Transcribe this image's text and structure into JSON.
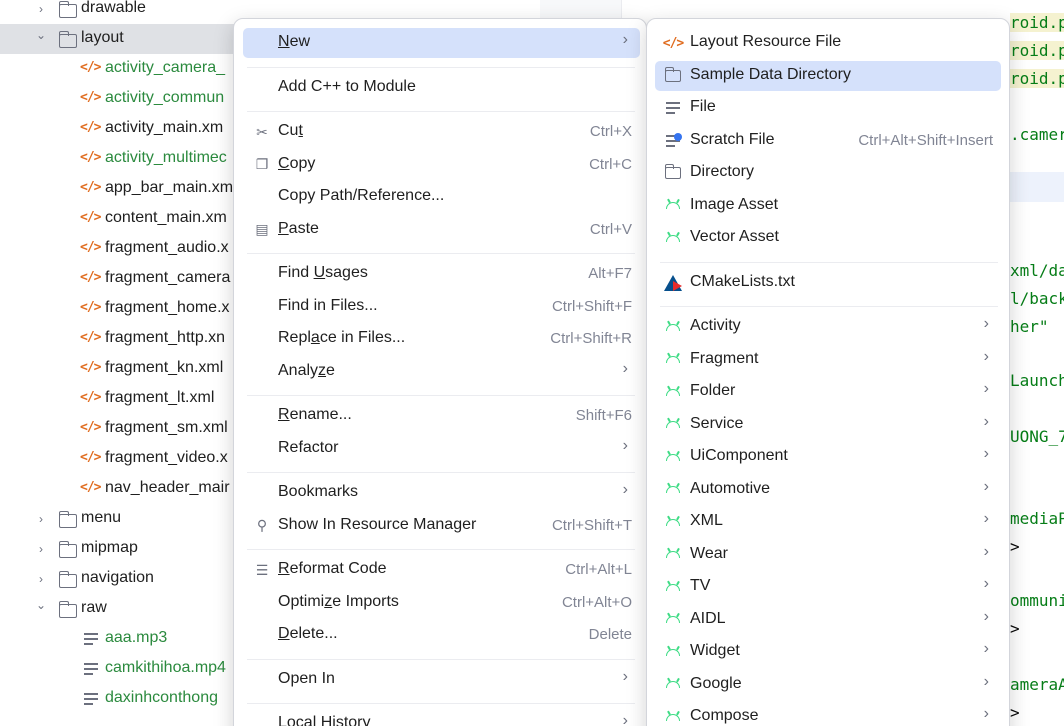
{
  "tree": {
    "rows": [
      {
        "label": "drawable",
        "kind": "folder",
        "expanded": false,
        "indent": 1
      },
      {
        "label": "layout",
        "kind": "folder",
        "expanded": true,
        "indent": 1,
        "selected": true
      },
      {
        "label": "activity_camera_",
        "kind": "xml",
        "color": "green"
      },
      {
        "label": "activity_commun",
        "kind": "xml",
        "color": "green"
      },
      {
        "label": "activity_main.xm",
        "kind": "xml",
        "color": "dark"
      },
      {
        "label": "activity_multimec",
        "kind": "xml",
        "color": "green"
      },
      {
        "label": "app_bar_main.xm",
        "kind": "xml",
        "color": "dark"
      },
      {
        "label": "content_main.xm",
        "kind": "xml",
        "color": "dark"
      },
      {
        "label": "fragment_audio.x",
        "kind": "xml",
        "color": "dark"
      },
      {
        "label": "fragment_camera",
        "kind": "xml",
        "color": "dark"
      },
      {
        "label": "fragment_home.x",
        "kind": "xml",
        "color": "dark"
      },
      {
        "label": "fragment_http.xn",
        "kind": "xml",
        "color": "dark"
      },
      {
        "label": "fragment_kn.xml",
        "kind": "xml",
        "color": "dark"
      },
      {
        "label": "fragment_lt.xml",
        "kind": "xml",
        "color": "dark"
      },
      {
        "label": "fragment_sm.xml",
        "kind": "xml",
        "color": "dark"
      },
      {
        "label": "fragment_video.x",
        "kind": "xml",
        "color": "dark"
      },
      {
        "label": "nav_header_mair",
        "kind": "xml",
        "color": "dark"
      },
      {
        "label": "menu",
        "kind": "folder",
        "expanded": false,
        "indent": 1
      },
      {
        "label": "mipmap",
        "kind": "folder",
        "expanded": false,
        "indent": 1
      },
      {
        "label": "navigation",
        "kind": "folder",
        "expanded": false,
        "indent": 1
      },
      {
        "label": "raw",
        "kind": "folder",
        "expanded": true,
        "indent": 1
      },
      {
        "label": "aaa.mp3",
        "kind": "file",
        "color": "green"
      },
      {
        "label": "camkithihoa.mp4",
        "kind": "file",
        "color": "green"
      },
      {
        "label": "daxinhconthong",
        "kind": "file",
        "color": "green"
      }
    ]
  },
  "editor": {
    "fragments": [
      {
        "text": "roid.p",
        "row": 0,
        "style": "hl"
      },
      {
        "text": "roid.p",
        "row": 1,
        "style": "hl"
      },
      {
        "text": "roid.p",
        "row": 2,
        "style": "hl"
      },
      {
        "text": ".camer",
        "row": 3,
        "style": "green"
      },
      {
        "text": "xml/da",
        "row": 6,
        "style": "green"
      },
      {
        "text": "l/back",
        "row": 7,
        "style": "green"
      },
      {
        "text": "her\"",
        "row": 8,
        "style": "green"
      },
      {
        "text": "Launch",
        "row": 9,
        "style": "green"
      },
      {
        "text": "UONG_7",
        "row": 10,
        "style": "green"
      },
      {
        "text": "mediaP",
        "row": 11,
        "style": "green"
      },
      {
        "text": ">",
        "row": 12,
        "style": "plain"
      },
      {
        "text": "ommuni",
        "row": 13,
        "style": "green"
      },
      {
        "text": ">",
        "row": 14,
        "style": "plain"
      },
      {
        "text": "ameraA",
        "row": 15,
        "style": "green"
      },
      {
        "text": ">",
        "row": 16,
        "style": "plain"
      }
    ]
  },
  "context_menu": {
    "items": [
      {
        "type": "item",
        "label": "New",
        "mnemonic": "N",
        "submenu": true,
        "active": true
      },
      {
        "type": "sep"
      },
      {
        "type": "item",
        "label": "Add C++ to Module"
      },
      {
        "type": "sep"
      },
      {
        "type": "item",
        "label": "Cut",
        "mnemonic": "t",
        "shortcut": "Ctrl+X",
        "icon": "scissors-icon"
      },
      {
        "type": "item",
        "label": "Copy",
        "mnemonic": "C",
        "shortcut": "Ctrl+C",
        "icon": "copy-icon"
      },
      {
        "type": "item",
        "label": "Copy Path/Reference..."
      },
      {
        "type": "item",
        "label": "Paste",
        "mnemonic": "P",
        "shortcut": "Ctrl+V",
        "icon": "paste-icon"
      },
      {
        "type": "sep"
      },
      {
        "type": "item",
        "label": "Find Usages",
        "mnemonic": "U",
        "shortcut": "Alt+F7"
      },
      {
        "type": "item",
        "label": "Find in Files...",
        "shortcut": "Ctrl+Shift+F"
      },
      {
        "type": "item",
        "label": "Replace in Files...",
        "mnemonic": "a",
        "shortcut": "Ctrl+Shift+R"
      },
      {
        "type": "item",
        "label": "Analyze",
        "mnemonic": "z",
        "submenu": true
      },
      {
        "type": "sep"
      },
      {
        "type": "item",
        "label": "Rename...",
        "mnemonic": "R",
        "shortcut": "Shift+F6"
      },
      {
        "type": "item",
        "label": "Refactor",
        "submenu": true
      },
      {
        "type": "sep"
      },
      {
        "type": "item",
        "label": "Bookmarks",
        "submenu": true
      },
      {
        "type": "item",
        "label": "Show In Resource Manager",
        "shortcut": "Ctrl+Shift+T",
        "icon": "resource-manager-icon"
      },
      {
        "type": "sep"
      },
      {
        "type": "item",
        "label": "Reformat Code",
        "mnemonic": "R",
        "shortcut": "Ctrl+Alt+L",
        "icon": "reformat-icon"
      },
      {
        "type": "item",
        "label": "Optimize Imports",
        "mnemonic": "z",
        "shortcut": "Ctrl+Alt+O"
      },
      {
        "type": "item",
        "label": "Delete...",
        "mnemonic": "D",
        "shortcut": "Delete"
      },
      {
        "type": "sep"
      },
      {
        "type": "item",
        "label": "Open In",
        "submenu": true
      },
      {
        "type": "sep"
      },
      {
        "type": "item",
        "label": "Local History",
        "mnemonic": "H",
        "submenu": true
      }
    ]
  },
  "new_submenu": {
    "items": [
      {
        "type": "item",
        "label": "Layout Resource File",
        "icon": "xml"
      },
      {
        "type": "item",
        "label": "Sample Data Directory",
        "icon": "folder",
        "active": true
      },
      {
        "type": "item",
        "label": "File",
        "icon": "lines"
      },
      {
        "type": "item",
        "label": "Scratch File",
        "icon": "scratch",
        "shortcut": "Ctrl+Alt+Shift+Insert"
      },
      {
        "type": "item",
        "label": "Directory",
        "icon": "folder"
      },
      {
        "type": "item",
        "label": "Image Asset",
        "icon": "android"
      },
      {
        "type": "item",
        "label": "Vector Asset",
        "icon": "android"
      },
      {
        "type": "sep"
      },
      {
        "type": "item",
        "label": "CMakeLists.txt",
        "icon": "cmake"
      },
      {
        "type": "sep"
      },
      {
        "type": "item",
        "label": "Activity",
        "icon": "android",
        "submenu": true
      },
      {
        "type": "item",
        "label": "Fragment",
        "icon": "android",
        "submenu": true
      },
      {
        "type": "item",
        "label": "Folder",
        "icon": "android",
        "submenu": true
      },
      {
        "type": "item",
        "label": "Service",
        "icon": "android",
        "submenu": true
      },
      {
        "type": "item",
        "label": "UiComponent",
        "icon": "android",
        "submenu": true
      },
      {
        "type": "item",
        "label": "Automotive",
        "icon": "android",
        "submenu": true
      },
      {
        "type": "item",
        "label": "XML",
        "icon": "android",
        "submenu": true
      },
      {
        "type": "item",
        "label": "Wear",
        "icon": "android",
        "submenu": true
      },
      {
        "type": "item",
        "label": "TV",
        "icon": "android",
        "submenu": true
      },
      {
        "type": "item",
        "label": "AIDL",
        "icon": "android",
        "submenu": true
      },
      {
        "type": "item",
        "label": "Widget",
        "icon": "android",
        "submenu": true
      },
      {
        "type": "item",
        "label": "Google",
        "icon": "android",
        "submenu": true
      },
      {
        "type": "item",
        "label": "Compose",
        "icon": "android",
        "submenu": true
      }
    ]
  }
}
